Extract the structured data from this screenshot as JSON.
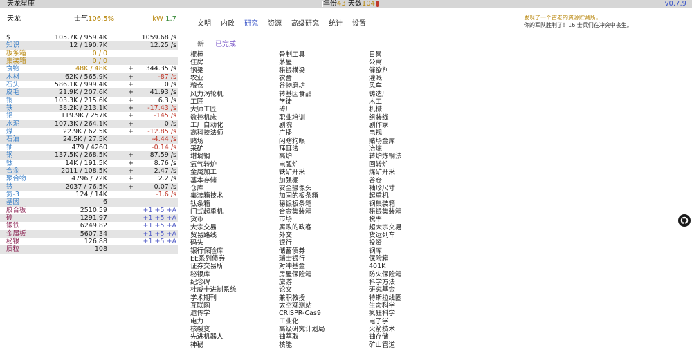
{
  "topbar": {
    "game_title": "天龙星座",
    "year_label": "年份",
    "year_value": "43",
    "days_label": "天数",
    "days_value": "104",
    "version": "v0.7.9"
  },
  "planet": {
    "name": "天龙",
    "morale_label": "士气",
    "morale_value": "106.5%",
    "power_label": "kW",
    "power_value": "1.7"
  },
  "colors": {
    "accent_blue": "#3a55c8",
    "gold": "#b8860b",
    "negative": "#c0392b",
    "power": "#3a8a3a",
    "purple": "#7a57c8"
  },
  "resources": [
    {
      "name": "$",
      "color": "#222",
      "amount": "105.7K / 959.4K",
      "sign": "",
      "rate": "1059.68 /s",
      "type": "normal"
    },
    {
      "name": "知识",
      "color": "#3a7fc8",
      "amount": "12 / 190.7K",
      "sign": "",
      "rate": "12.25 /s",
      "type": "normal"
    },
    {
      "name": "板条箱",
      "color": "#b8860b",
      "amount": "0 / 0",
      "sign": "",
      "rate": "",
      "type": "full"
    },
    {
      "name": "集装箱",
      "color": "#b8860b",
      "amount": "0 / 0",
      "sign": "",
      "rate": "",
      "type": "full"
    },
    {
      "name": "食物",
      "color": "#3a7fc8",
      "amount": "48K / 48K",
      "sign": "+",
      "rate": "344.35 /s",
      "type": "full"
    },
    {
      "name": "木材",
      "color": "#3a7fc8",
      "amount": "62K / 565.9K",
      "sign": "+",
      "rate": "-87 /s",
      "type": "neg"
    },
    {
      "name": "石头",
      "color": "#3a7fc8",
      "amount": "586.1K / 999.4K",
      "sign": "+",
      "rate": "0 /s",
      "type": "normal"
    },
    {
      "name": "皮毛",
      "color": "#3a7fc8",
      "amount": "21.9K / 207.6K",
      "sign": "+",
      "rate": "41.93 /s",
      "type": "normal"
    },
    {
      "name": "铜",
      "color": "#3a7fc8",
      "amount": "103.3K / 215.6K",
      "sign": "+",
      "rate": "6.3 /s",
      "type": "normal"
    },
    {
      "name": "铁",
      "color": "#3a7fc8",
      "amount": "38.2K / 213.1K",
      "sign": "+",
      "rate": "-17.43 /s",
      "type": "neg"
    },
    {
      "name": "铝",
      "color": "#3a7fc8",
      "amount": "119.9K / 257K",
      "sign": "+",
      "rate": "-145 /s",
      "type": "neg"
    },
    {
      "name": "水泥",
      "color": "#3a7fc8",
      "amount": "107.3K / 264.1K",
      "sign": "+",
      "rate": "0 /s",
      "type": "normal"
    },
    {
      "name": "煤",
      "color": "#3a7fc8",
      "amount": "22.9K / 62.5K",
      "sign": "+",
      "rate": "-12.85 /s",
      "type": "neg"
    },
    {
      "name": "石油",
      "color": "#3a7fc8",
      "amount": "24.5K / 27.5K",
      "sign": "",
      "rate": "-4.44 /s",
      "type": "neg"
    },
    {
      "name": "铀",
      "color": "#3a7fc8",
      "amount": "479 / 4260",
      "sign": "",
      "rate": "-0.14 /s",
      "type": "neg"
    },
    {
      "name": "钢",
      "color": "#3a7fc8",
      "amount": "137.5K / 268.5K",
      "sign": "+",
      "rate": "87.59 /s",
      "type": "normal"
    },
    {
      "name": "钛",
      "color": "#3a7fc8",
      "amount": "14K / 191.5K",
      "sign": "+",
      "rate": "8.76 /s",
      "type": "normal"
    },
    {
      "name": "合金",
      "color": "#3a7fc8",
      "amount": "2011 / 108.5K",
      "sign": "+",
      "rate": "2.47 /s",
      "type": "normal"
    },
    {
      "name": "聚合物",
      "color": "#3a7fc8",
      "amount": "4796 / 72K",
      "sign": "+",
      "rate": "2.2 /s",
      "type": "normal"
    },
    {
      "name": "铱",
      "color": "#3a7fc8",
      "amount": "2037 / 76.5K",
      "sign": "+",
      "rate": "0.07 /s",
      "type": "normal"
    },
    {
      "name": "氦-3",
      "color": "#3a7fc8",
      "amount": "124 / 14K",
      "sign": "",
      "rate": "-1.6 /s",
      "type": "neg"
    },
    {
      "name": "基因",
      "color": "#3a7fc8",
      "amount": "6",
      "sign": "",
      "rate": "",
      "type": "normal"
    },
    {
      "name": "胶合板",
      "color": "#8b2252",
      "amount": "2510.59",
      "sign": "",
      "rate": "+1 +5 +A",
      "type": "craft"
    },
    {
      "name": "砖",
      "color": "#8b2252",
      "amount": "1291.97",
      "sign": "",
      "rate": "+1 +5 +A",
      "type": "craft"
    },
    {
      "name": "锻铁",
      "color": "#8b2252",
      "amount": "6249.82",
      "sign": "",
      "rate": "+1 +5 +A",
      "type": "craft"
    },
    {
      "name": "金属板",
      "color": "#8b2252",
      "amount": "5607.34",
      "sign": "",
      "rate": "+1 +5 +A",
      "type": "craft"
    },
    {
      "name": "秘银",
      "color": "#8b2252",
      "amount": "126.88",
      "sign": "",
      "rate": "+1 +5 +A",
      "type": "craft"
    },
    {
      "name": "质粒",
      "color": "#8b2252",
      "amount": "108",
      "sign": "",
      "rate": "",
      "type": "normal"
    }
  ],
  "tabs": [
    {
      "label": "文明",
      "active": false
    },
    {
      "label": "内政",
      "active": false
    },
    {
      "label": "研究",
      "active": true
    },
    {
      "label": "资源",
      "active": false
    },
    {
      "label": "高级研究",
      "active": false
    },
    {
      "label": "统计",
      "active": false
    },
    {
      "label": "设置",
      "active": false
    }
  ],
  "subtabs": [
    {
      "label": "新",
      "active": false
    },
    {
      "label": "已完成",
      "active": true
    }
  ],
  "tech_columns": [
    [
      "棍棒",
      "住房",
      "钢梁",
      "农业",
      "粮仓",
      "风力涡轮机",
      "工匠",
      "大师工匠",
      "数控机床",
      "工厂自动化",
      "高科技法师",
      "赌场",
      "采矿",
      "坩埚钢",
      "氧气转炉",
      "金属加工",
      "基本存储",
      "仓库",
      "集装箱技术",
      "钛条箱",
      "门式起重机",
      "货币",
      "大宗交易",
      "贸易路线",
      "码头",
      "银行保险库",
      "EE系列债券",
      "证券交易所",
      "秘银库",
      "纪念碑",
      "杜威十进制系统",
      "学术期刊",
      "互联网",
      "遗传学",
      "电力",
      "核裂变",
      "先进机器人",
      "神秘"
    ],
    [
      "骨制工具",
      "茅屋",
      "秘银横梁",
      "农舍",
      "谷物磨坊",
      "转基因食品",
      "学徒",
      "砖厂",
      "职业培训",
      "剧院",
      "广播",
      "闪瞎狗眼",
      "拜耳法",
      "高炉",
      "电弧炉",
      "铁矿开采",
      "加强棚",
      "安全摄像头",
      "加固的板条箱",
      "秘银板条箱",
      "合金集装箱",
      "市场",
      "腐败的政客",
      "外交",
      "银行",
      "储蓄债券",
      "瑞士银行",
      "对冲基金",
      "房屋保险箱",
      "旅游",
      "论文",
      "兼职教授",
      "太空观测站",
      "CRISPR-Cas9",
      "工业化",
      "高级研究计划局",
      "铀萃取",
      "核能"
    ],
    [
      "日晷",
      "公寓",
      "催欲剂",
      "灌溉",
      "风车",
      "铸造厂",
      "木工",
      "机械",
      "组装线",
      "剧作家",
      "电视",
      "赌场金库",
      "冶炼",
      "转炉炼钢法",
      "回转炉",
      "煤矿开采",
      "谷仓",
      "袖珍尺寸",
      "起重机",
      "钢集装箱",
      "秘银集装箱",
      "税率",
      "超大宗交易",
      "货运列车",
      "投资",
      "钢库",
      "保险箱",
      "401K",
      "防火保险箱",
      "科学方法",
      "研究基金",
      "特斯拉线圈",
      "生命科学",
      "疯狂科学",
      "电子学",
      "火箭技术",
      "铀存储",
      "矿山管道"
    ]
  ],
  "log": [
    {
      "text": "发现了一个古老的资源贮藏所。",
      "type": "notice"
    },
    {
      "text": "你的军队胜利了！16 士兵们在冲突中丧生。",
      "type": "normal"
    }
  ],
  "github_icon": "github-icon"
}
